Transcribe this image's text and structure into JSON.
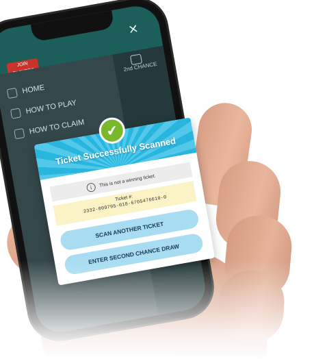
{
  "app": {
    "logo_text": "JOIN\nPLAYERS",
    "close_symbol": "×"
  },
  "menu": {
    "items": [
      {
        "label": "HOME"
      },
      {
        "label": "HOW TO PLAY"
      },
      {
        "label": "HOW TO CLAIM"
      }
    ]
  },
  "side_panel": {
    "label": "2nd CHANCE"
  },
  "dialog": {
    "title": "Ticket Successfully Scanned",
    "check_symbol": "✔",
    "info_icon": "i",
    "message": "This is not a winning ticket.",
    "ticket_label": "Ticket #:",
    "ticket_number": "2332-009795-018-6705476610-0",
    "buttons": {
      "scan_another": "SCAN ANOTHER TICKET",
      "second_chance": "ENTER SECOND CHANCE DRAW"
    }
  },
  "colors": {
    "header_blue": "#29b6de",
    "success_green": "#78b82a",
    "button_blue": "#a8dcf1",
    "ticket_yellow": "#fbf3c6",
    "app_teal": "#1c5e5a"
  },
  "icons": [
    "check-icon",
    "info-icon",
    "close-icon",
    "home-icon",
    "play-icon",
    "claim-icon",
    "second-chance-icon"
  ]
}
